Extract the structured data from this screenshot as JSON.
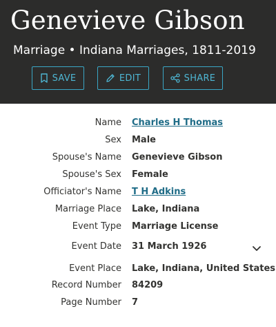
{
  "header": {
    "title": "Genevieve Gibson",
    "subtitle": "Marriage • Indiana Marriages, 1811-2019"
  },
  "actions": {
    "save_label": "SAVE",
    "edit_label": "EDIT",
    "share_label": "SHARE"
  },
  "record": {
    "name": {
      "label": "Name",
      "value": "Charles H Thomas"
    },
    "sex": {
      "label": "Sex",
      "value": "Male"
    },
    "spouse_name": {
      "label": "Spouse's Name",
      "value": "Genevieve Gibson"
    },
    "spouse_sex": {
      "label": "Spouse's Sex",
      "value": "Female"
    },
    "officiator": {
      "label": "Officiator's Name",
      "value": "T H Adkins"
    },
    "marriage_place": {
      "label": "Marriage Place",
      "value": "Lake, Indiana"
    },
    "event_type": {
      "label": "Event Type",
      "value": "Marriage License"
    },
    "event_date": {
      "label": "Event Date",
      "value": "31 March 1926"
    },
    "event_place": {
      "label": "Event Place",
      "value": "Lake, Indiana, United States"
    },
    "record_number": {
      "label": "Record Number",
      "value": "84209"
    },
    "page_number": {
      "label": "Page Number",
      "value": "7"
    }
  },
  "colors": {
    "header_bg": "#2c2c2b",
    "accent": "#4eb6d3",
    "link": "#1f6c87"
  }
}
